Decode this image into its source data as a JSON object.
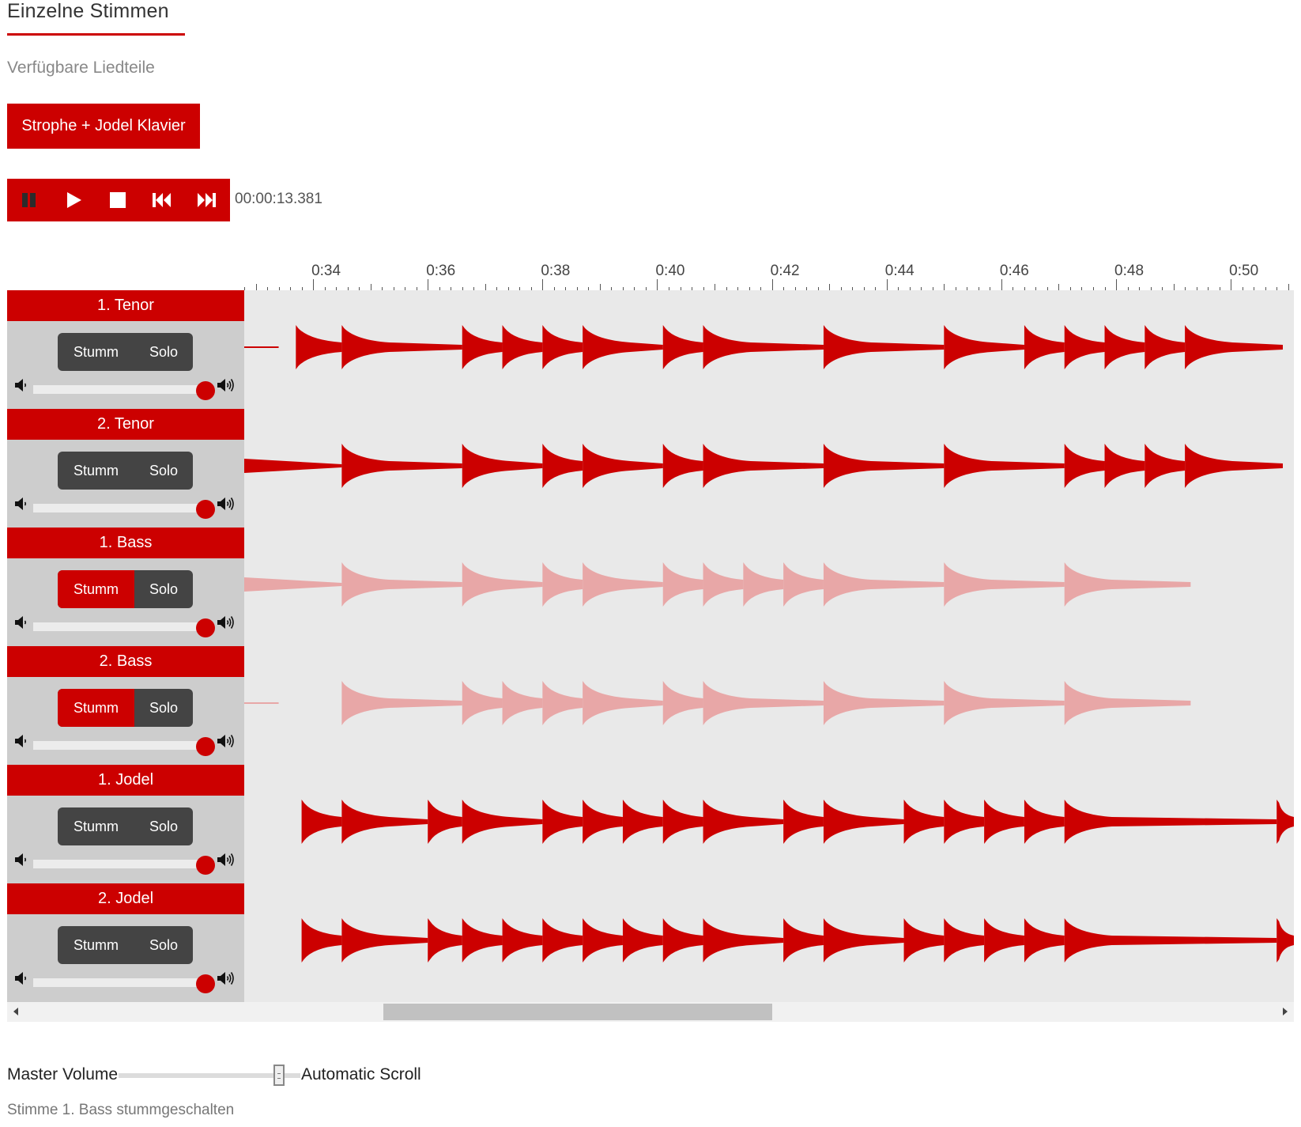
{
  "header": {
    "title": "Einzelne Stimmen",
    "subtitle": "Verfügbare Liedteile"
  },
  "parts": {
    "selected_label": "Strophe + Jodel Klavier"
  },
  "transport": {
    "buttons": [
      {
        "name": "pause-button",
        "icon": "pause-icon"
      },
      {
        "name": "play-button",
        "icon": "play-icon"
      },
      {
        "name": "stop-button",
        "icon": "stop-icon"
      },
      {
        "name": "rewind-button",
        "icon": "skip-back-icon"
      },
      {
        "name": "fast-forward-button",
        "icon": "skip-forward-icon"
      }
    ],
    "time": "00:00:13.381"
  },
  "ruler": {
    "labels": [
      "0:34",
      "0:36",
      "0:38",
      "0:40",
      "0:42",
      "0:44",
      "0:46",
      "0:48",
      "0:50"
    ],
    "start_seconds": 32.8,
    "end_seconds": 51.1
  },
  "tracks": [
    {
      "name": "1. Tenor",
      "mute_label": "Stumm",
      "solo_label": "Solo",
      "muted": false,
      "solo": false,
      "volume": 1.0,
      "onsets": [
        33.7,
        34.5,
        36.6,
        37.3,
        38.0,
        38.7,
        40.1,
        40.8,
        42.9,
        45.0,
        46.4,
        47.1,
        47.8,
        48.5,
        49.2
      ],
      "lead_tail": true
    },
    {
      "name": "2. Tenor",
      "mute_label": "Stumm",
      "solo_label": "Solo",
      "muted": false,
      "solo": false,
      "volume": 1.0,
      "onsets": [
        32.8,
        34.5,
        36.6,
        38.0,
        38.7,
        40.1,
        40.8,
        42.9,
        45.0,
        47.1,
        47.8,
        48.5,
        49.2
      ],
      "lead_tail": false
    },
    {
      "name": "1. Bass",
      "mute_label": "Stumm",
      "solo_label": "Solo",
      "muted": true,
      "solo": false,
      "volume": 1.0,
      "onsets": [
        32.8,
        34.5,
        36.6,
        38.0,
        38.7,
        40.1,
        40.8,
        41.5,
        42.2,
        42.9,
        45.0,
        47.1
      ],
      "lead_tail": false
    },
    {
      "name": "2. Bass",
      "mute_label": "Stumm",
      "solo_label": "Solo",
      "muted": true,
      "solo": false,
      "volume": 1.0,
      "onsets": [
        34.5,
        36.6,
        37.3,
        38.0,
        38.7,
        40.1,
        40.8,
        42.9,
        45.0,
        47.1
      ],
      "lead_tail": true
    },
    {
      "name": "1. Jodel",
      "mute_label": "Stumm",
      "solo_label": "Solo",
      "muted": false,
      "solo": false,
      "volume": 1.0,
      "onsets": [
        33.8,
        34.5,
        36.0,
        36.6,
        38.0,
        38.7,
        39.4,
        40.1,
        40.8,
        42.2,
        42.9,
        44.3,
        45.0,
        45.7,
        46.4,
        47.1,
        50.8
      ],
      "lead_tail": false
    },
    {
      "name": "2. Jodel",
      "mute_label": "Stumm",
      "solo_label": "Solo",
      "muted": false,
      "solo": false,
      "volume": 1.0,
      "onsets": [
        33.8,
        34.5,
        36.0,
        36.6,
        37.3,
        38.0,
        38.7,
        39.4,
        40.1,
        40.8,
        42.2,
        42.9,
        44.3,
        45.0,
        45.7,
        46.4,
        47.1,
        50.8
      ],
      "lead_tail": false
    }
  ],
  "scrollbar": {
    "position_fraction": 0.48,
    "visible_fraction": 0.31
  },
  "footer": {
    "master_volume_label": "Master Volume",
    "master_volume_value": 0.85,
    "automatic_scroll_label": "Automatic Scroll",
    "status": "Stimme 1. Bass stummgeschalten"
  },
  "colors": {
    "accent": "#cc0000",
    "muted_wave": "#e8a7a7",
    "track_bg": "#e9e9e9",
    "control_bg": "#cdcdcd",
    "button_dark": "#444444"
  }
}
